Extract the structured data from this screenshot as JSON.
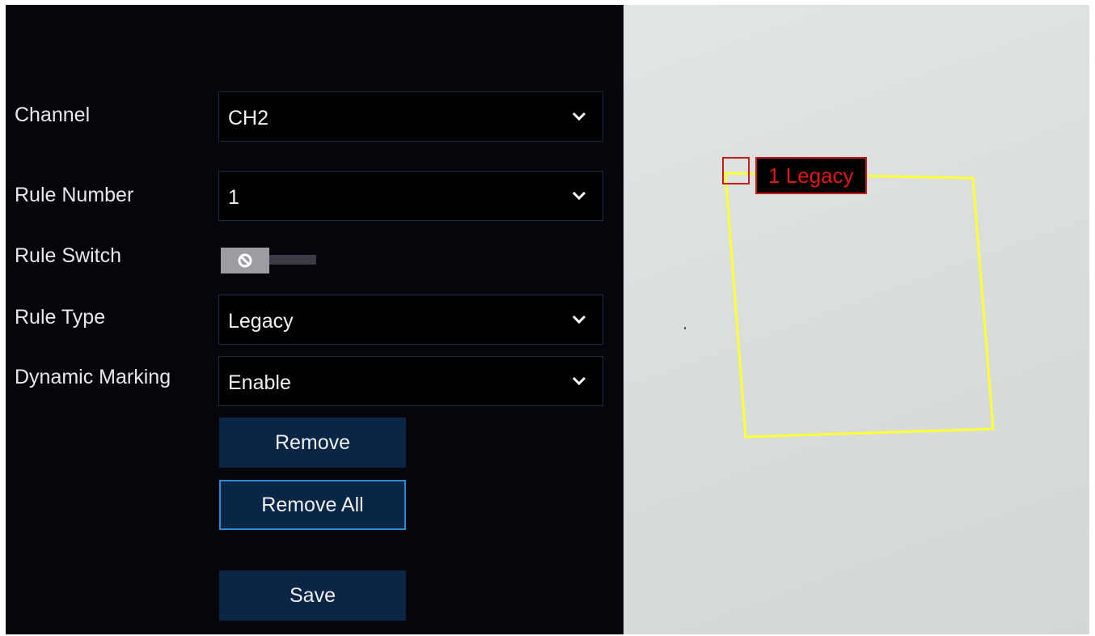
{
  "settings": {
    "channel": {
      "label": "Channel",
      "value": "CH2"
    },
    "rule_number": {
      "label": "Rule Number",
      "value": "1"
    },
    "rule_switch": {
      "label": "Rule Switch",
      "state": "off"
    },
    "rule_type": {
      "label": "Rule Type",
      "value": "Legacy"
    },
    "dynamic_marking": {
      "label": "Dynamic Marking",
      "value": "Enable"
    }
  },
  "buttons": {
    "remove": "Remove",
    "remove_all": "Remove All",
    "save": "Save"
  },
  "preview": {
    "zone_label": "1 Legacy",
    "zone_color": "#ffff33",
    "label_color": "#e01515"
  },
  "colors": {
    "panel_background": "#05050c",
    "button_background": "#0b2547",
    "focus_border": "#2f8ad6"
  }
}
